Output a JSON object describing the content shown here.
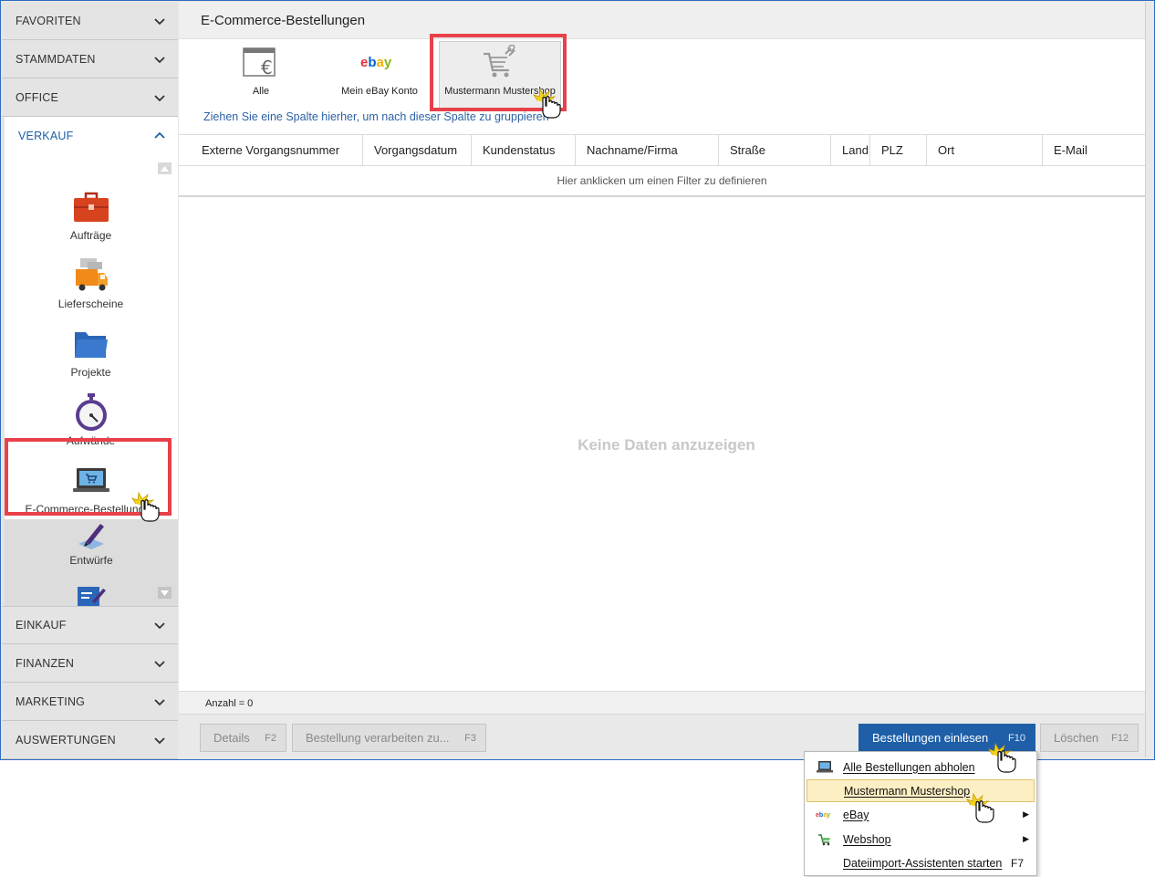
{
  "sidebar": {
    "categories_top": [
      "FAVORITEN",
      "STAMMDATEN",
      "OFFICE"
    ],
    "open_category": "VERKAUF",
    "verkauf_items": [
      {
        "label": "Aufträge",
        "icon": "briefcase-icon"
      },
      {
        "label": "Lieferscheine",
        "icon": "delivery-truck-icon"
      },
      {
        "label": "Projekte",
        "icon": "folder-icon"
      },
      {
        "label": "Aufwände",
        "icon": "stopwatch-icon"
      },
      {
        "label": "E-Commerce-Bestellungen",
        "icon": "laptop-cart-icon"
      },
      {
        "label": "Entwürfe",
        "icon": "pen-icon"
      }
    ],
    "categories_bottom": [
      "EINKAUF",
      "FINANZEN",
      "MARKETING",
      "AUSWERTUNGEN"
    ]
  },
  "main": {
    "title": "E-Commerce-Bestellungen",
    "shops": [
      {
        "label": "Alle",
        "icon": "euro-window-icon"
      },
      {
        "label": "Mein eBay Konto",
        "icon": "ebay-logo-icon"
      },
      {
        "label": "Mustermann Mustershop",
        "icon": "shop-cart-link-icon",
        "selected": true
      }
    ],
    "group_hint": "Ziehen Sie eine Spalte hierher, um nach dieser Spalte zu gruppieren",
    "columns": [
      "Externe Vorgangsnummer",
      "Vorgangsdatum",
      "Kundenstatus",
      "Nachname/Firma",
      "Straße",
      "Land",
      "PLZ",
      "Ort",
      "E-Mail"
    ],
    "filter_hint": "Hier anklicken um einen Filter zu definieren",
    "empty_text": "Keine Daten anzuzeigen",
    "count_label": "Anzahl = 0"
  },
  "buttons": {
    "details": {
      "label": "Details",
      "key": "F2"
    },
    "process": {
      "label": "Bestellung verarbeiten zu...",
      "key": "F3"
    },
    "import": {
      "label": "Bestellungen einlesen",
      "key": "F10"
    },
    "delete": {
      "label": "Löschen",
      "key": "F12"
    }
  },
  "context_menu": {
    "items": [
      {
        "label": "Alle Bestellungen abholen",
        "icon": "laptop-cart-icon"
      },
      {
        "label": "Mustermann Mustershop",
        "icon": "",
        "highlighted": true
      },
      {
        "label": "eBay",
        "icon": "ebay-logo-icon",
        "submenu": true
      },
      {
        "label": "Webshop",
        "icon": "webshop-cart-icon",
        "submenu": true
      },
      {
        "label": "Dateiimport-Assistenten starten",
        "icon": "",
        "shortcut": "F7"
      }
    ]
  },
  "colors": {
    "accent": "#1e5fa8",
    "highlight": "#e8414a",
    "sidebar_active_text": "#1d5fa8"
  }
}
